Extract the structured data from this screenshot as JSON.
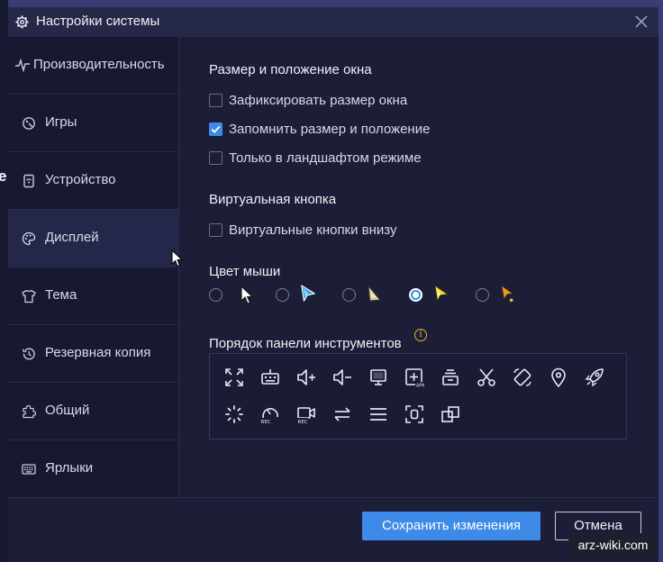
{
  "window": {
    "title": "Настройки системы",
    "icon": "gear-icon",
    "close_icon": "close-icon"
  },
  "sidebar": {
    "items": [
      {
        "label": "Производительность",
        "icon": "pulse-icon",
        "active": false
      },
      {
        "label": "Игры",
        "icon": "gamepad-icon",
        "active": false
      },
      {
        "label": "Устройство",
        "icon": "device-icon",
        "active": false
      },
      {
        "label": "Дисплей",
        "icon": "palette-icon",
        "active": true
      },
      {
        "label": "Тема",
        "icon": "shirt-icon",
        "active": false
      },
      {
        "label": "Резервная копия",
        "icon": "history-icon",
        "active": false
      },
      {
        "label": "Общий",
        "icon": "puzzle-icon",
        "active": false
      },
      {
        "label": "Ярлыки",
        "icon": "keyboard-icon",
        "active": false
      }
    ]
  },
  "window_size_section": {
    "title": "Размер и положение окна",
    "options": [
      {
        "label": "Зафиксировать размер окна",
        "checked": false
      },
      {
        "label": "Запомнить размер и положение",
        "checked": true
      },
      {
        "label": "Только в ландшафтом режиме",
        "checked": false
      }
    ]
  },
  "virtual_button_section": {
    "title": "Виртуальная кнопка",
    "options": [
      {
        "label": "Виртуальные кнопки внизу",
        "checked": false
      }
    ]
  },
  "mouse_color_section": {
    "title": "Цвет мыши",
    "selected_index": 3,
    "cursors": [
      {
        "icon": "cursor-white-icon",
        "color": "#ffffff"
      },
      {
        "icon": "cursor-blue-icon",
        "color": "#3aa0e8"
      },
      {
        "icon": "cursor-beige-icon",
        "color": "#d9c79a"
      },
      {
        "icon": "cursor-yellow-icon",
        "color": "#f2df1c"
      },
      {
        "icon": "cursor-orange-icon",
        "color": "#f29a1c"
      }
    ]
  },
  "toolbar_order_section": {
    "title": "Порядок панели инструментов",
    "info_icon": "info-icon",
    "tools": [
      "fullscreen-icon",
      "keyboard-mapping-icon",
      "volume-up-icon",
      "volume-down-icon",
      "screen-icon",
      "install-apk-icon",
      "multi-instance-icon",
      "screenshot-cut-icon",
      "rotate-icon",
      "location-icon",
      "rocket-icon",
      "loading-icon",
      "record-macro-icon",
      "record-video-icon",
      "sync-icon",
      "menu-icon",
      "screenshot-icon",
      "window-copy-icon"
    ]
  },
  "footer": {
    "save_label": "Сохранить изменения",
    "cancel_label": "Отмена"
  },
  "watermark": "arz-wiki.com",
  "colors": {
    "accent": "#3d8ae8",
    "dialog_bg": "#1c1e38",
    "sidebar_bg": "#171930",
    "active_tab_bg": "#25274a"
  }
}
